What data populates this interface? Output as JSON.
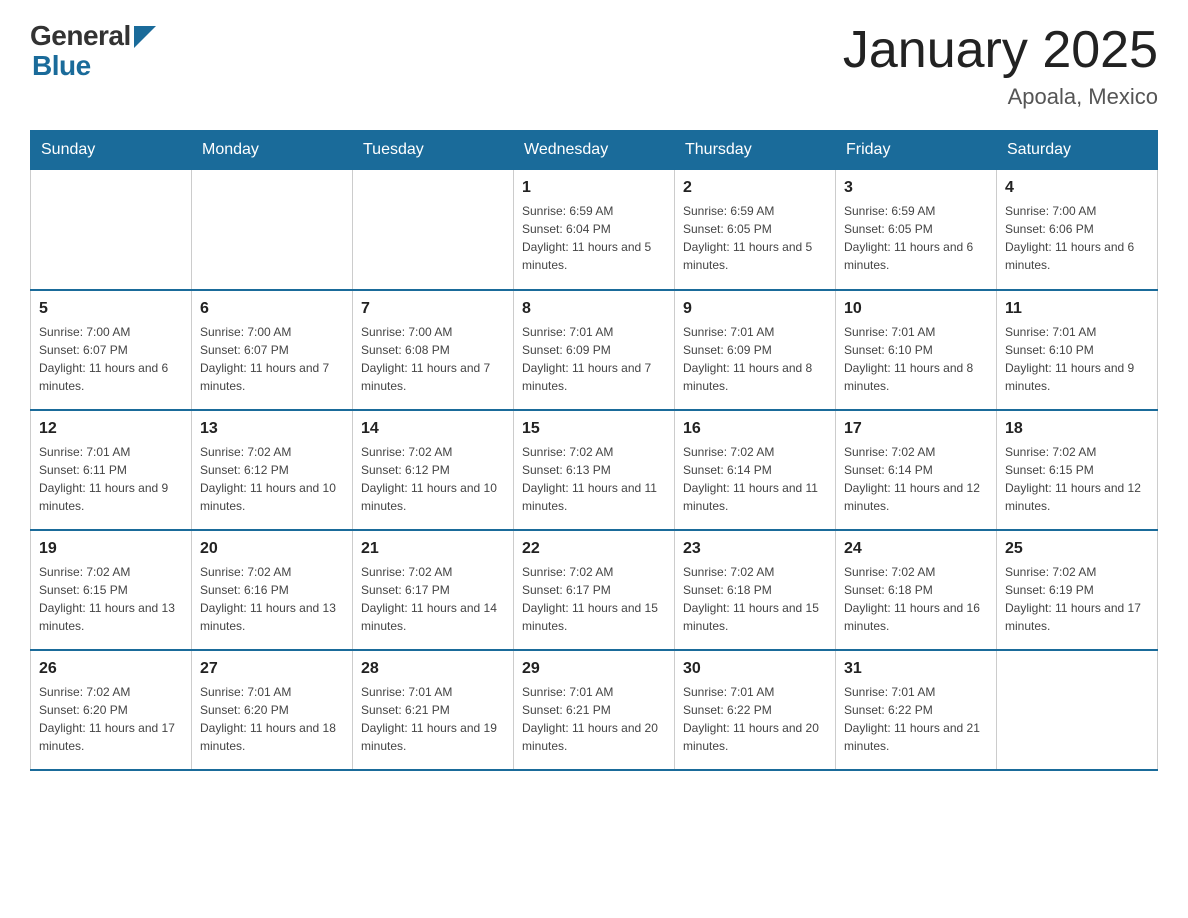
{
  "header": {
    "logo_text1": "General",
    "logo_text2": "Blue",
    "title": "January 2025",
    "subtitle": "Apoala, Mexico"
  },
  "days_of_week": [
    "Sunday",
    "Monday",
    "Tuesday",
    "Wednesday",
    "Thursday",
    "Friday",
    "Saturday"
  ],
  "weeks": [
    [
      {
        "day": "",
        "info": ""
      },
      {
        "day": "",
        "info": ""
      },
      {
        "day": "",
        "info": ""
      },
      {
        "day": "1",
        "info": "Sunrise: 6:59 AM\nSunset: 6:04 PM\nDaylight: 11 hours and 5 minutes."
      },
      {
        "day": "2",
        "info": "Sunrise: 6:59 AM\nSunset: 6:05 PM\nDaylight: 11 hours and 5 minutes."
      },
      {
        "day": "3",
        "info": "Sunrise: 6:59 AM\nSunset: 6:05 PM\nDaylight: 11 hours and 6 minutes."
      },
      {
        "day": "4",
        "info": "Sunrise: 7:00 AM\nSunset: 6:06 PM\nDaylight: 11 hours and 6 minutes."
      }
    ],
    [
      {
        "day": "5",
        "info": "Sunrise: 7:00 AM\nSunset: 6:07 PM\nDaylight: 11 hours and 6 minutes."
      },
      {
        "day": "6",
        "info": "Sunrise: 7:00 AM\nSunset: 6:07 PM\nDaylight: 11 hours and 7 minutes."
      },
      {
        "day": "7",
        "info": "Sunrise: 7:00 AM\nSunset: 6:08 PM\nDaylight: 11 hours and 7 minutes."
      },
      {
        "day": "8",
        "info": "Sunrise: 7:01 AM\nSunset: 6:09 PM\nDaylight: 11 hours and 7 minutes."
      },
      {
        "day": "9",
        "info": "Sunrise: 7:01 AM\nSunset: 6:09 PM\nDaylight: 11 hours and 8 minutes."
      },
      {
        "day": "10",
        "info": "Sunrise: 7:01 AM\nSunset: 6:10 PM\nDaylight: 11 hours and 8 minutes."
      },
      {
        "day": "11",
        "info": "Sunrise: 7:01 AM\nSunset: 6:10 PM\nDaylight: 11 hours and 9 minutes."
      }
    ],
    [
      {
        "day": "12",
        "info": "Sunrise: 7:01 AM\nSunset: 6:11 PM\nDaylight: 11 hours and 9 minutes."
      },
      {
        "day": "13",
        "info": "Sunrise: 7:02 AM\nSunset: 6:12 PM\nDaylight: 11 hours and 10 minutes."
      },
      {
        "day": "14",
        "info": "Sunrise: 7:02 AM\nSunset: 6:12 PM\nDaylight: 11 hours and 10 minutes."
      },
      {
        "day": "15",
        "info": "Sunrise: 7:02 AM\nSunset: 6:13 PM\nDaylight: 11 hours and 11 minutes."
      },
      {
        "day": "16",
        "info": "Sunrise: 7:02 AM\nSunset: 6:14 PM\nDaylight: 11 hours and 11 minutes."
      },
      {
        "day": "17",
        "info": "Sunrise: 7:02 AM\nSunset: 6:14 PM\nDaylight: 11 hours and 12 minutes."
      },
      {
        "day": "18",
        "info": "Sunrise: 7:02 AM\nSunset: 6:15 PM\nDaylight: 11 hours and 12 minutes."
      }
    ],
    [
      {
        "day": "19",
        "info": "Sunrise: 7:02 AM\nSunset: 6:15 PM\nDaylight: 11 hours and 13 minutes."
      },
      {
        "day": "20",
        "info": "Sunrise: 7:02 AM\nSunset: 6:16 PM\nDaylight: 11 hours and 13 minutes."
      },
      {
        "day": "21",
        "info": "Sunrise: 7:02 AM\nSunset: 6:17 PM\nDaylight: 11 hours and 14 minutes."
      },
      {
        "day": "22",
        "info": "Sunrise: 7:02 AM\nSunset: 6:17 PM\nDaylight: 11 hours and 15 minutes."
      },
      {
        "day": "23",
        "info": "Sunrise: 7:02 AM\nSunset: 6:18 PM\nDaylight: 11 hours and 15 minutes."
      },
      {
        "day": "24",
        "info": "Sunrise: 7:02 AM\nSunset: 6:18 PM\nDaylight: 11 hours and 16 minutes."
      },
      {
        "day": "25",
        "info": "Sunrise: 7:02 AM\nSunset: 6:19 PM\nDaylight: 11 hours and 17 minutes."
      }
    ],
    [
      {
        "day": "26",
        "info": "Sunrise: 7:02 AM\nSunset: 6:20 PM\nDaylight: 11 hours and 17 minutes."
      },
      {
        "day": "27",
        "info": "Sunrise: 7:01 AM\nSunset: 6:20 PM\nDaylight: 11 hours and 18 minutes."
      },
      {
        "day": "28",
        "info": "Sunrise: 7:01 AM\nSunset: 6:21 PM\nDaylight: 11 hours and 19 minutes."
      },
      {
        "day": "29",
        "info": "Sunrise: 7:01 AM\nSunset: 6:21 PM\nDaylight: 11 hours and 20 minutes."
      },
      {
        "day": "30",
        "info": "Sunrise: 7:01 AM\nSunset: 6:22 PM\nDaylight: 11 hours and 20 minutes."
      },
      {
        "day": "31",
        "info": "Sunrise: 7:01 AM\nSunset: 6:22 PM\nDaylight: 11 hours and 21 minutes."
      },
      {
        "day": "",
        "info": ""
      }
    ]
  ]
}
